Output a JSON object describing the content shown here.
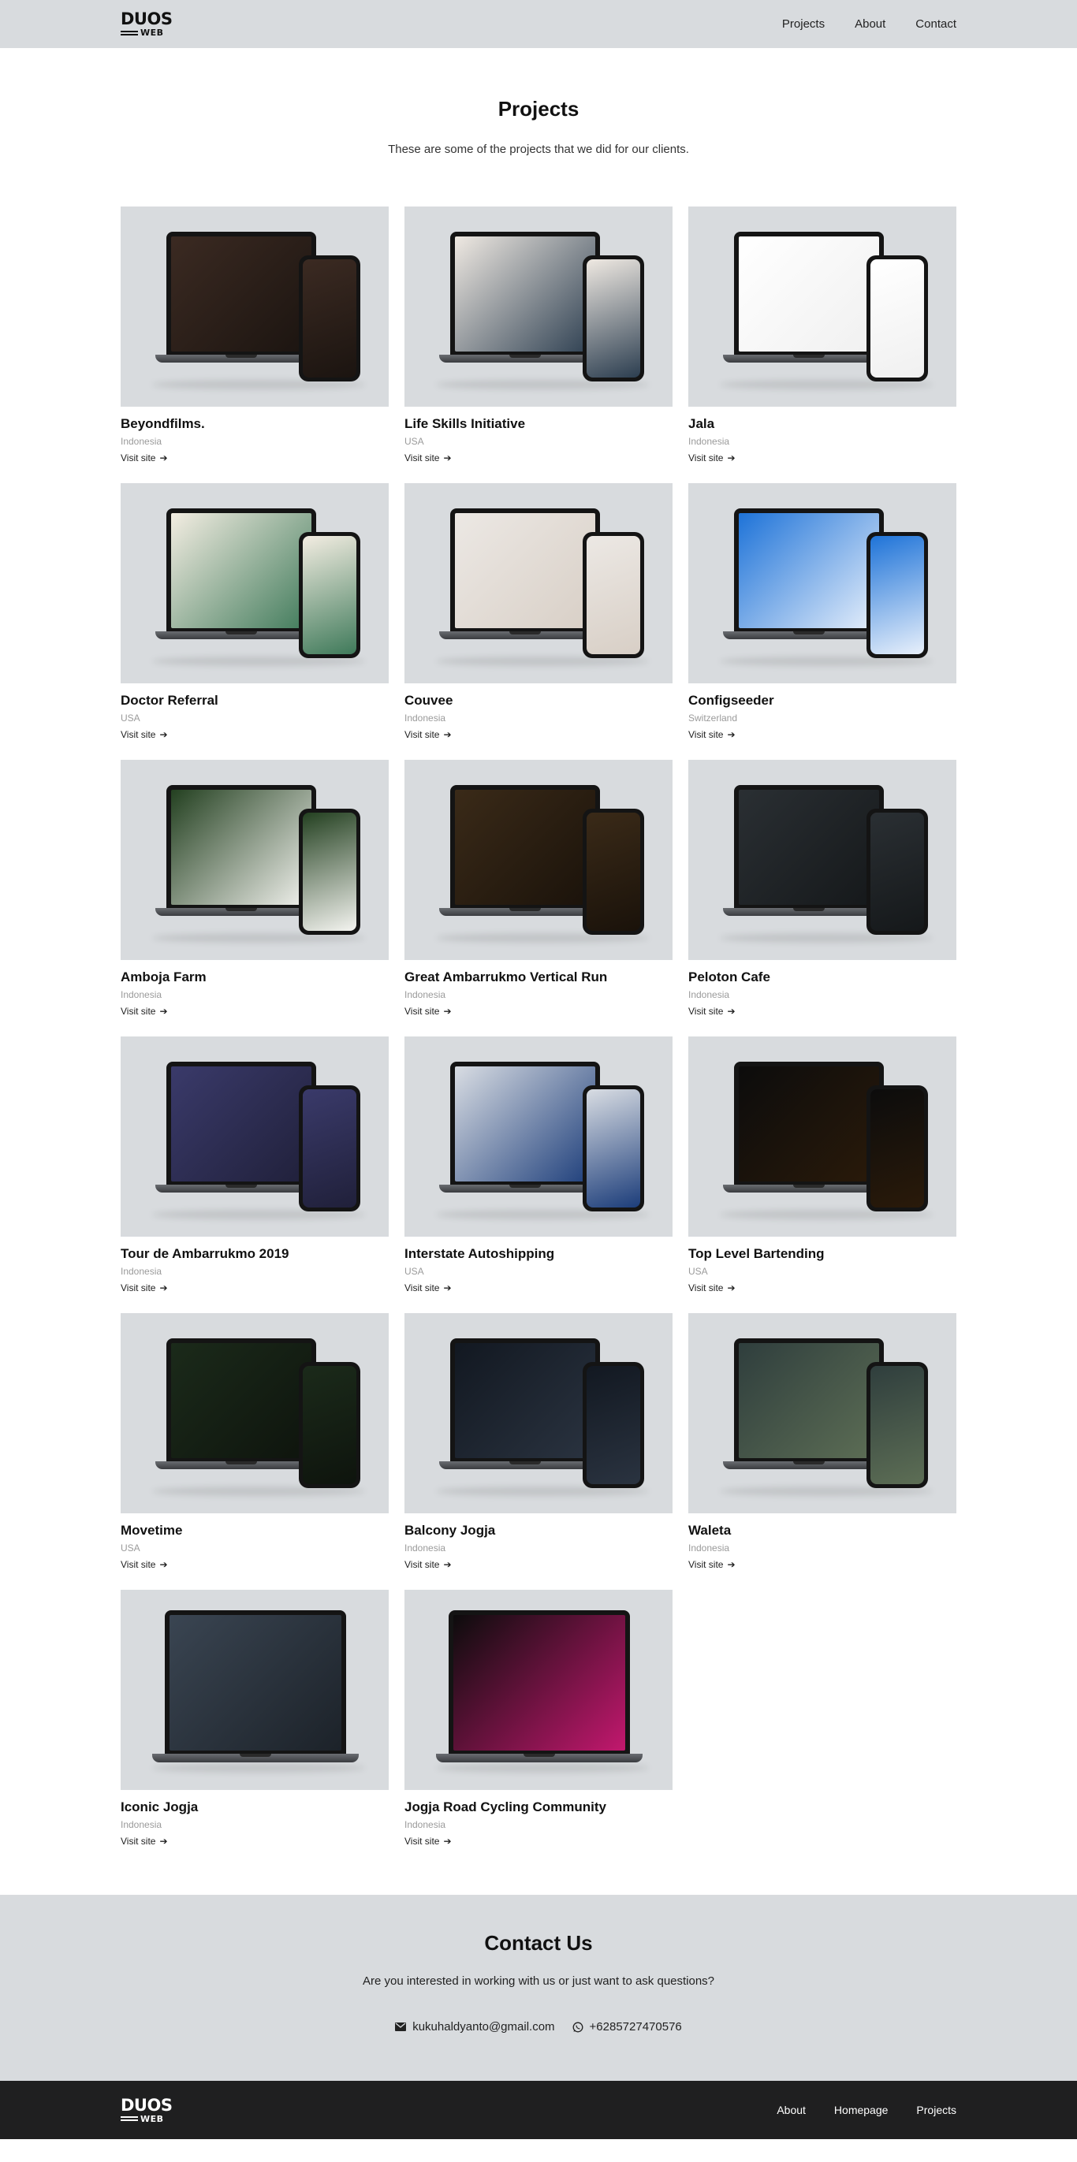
{
  "header": {
    "logo_top": "DUOS",
    "logo_bottom": "WEB",
    "nav": [
      "Projects",
      "About",
      "Contact"
    ]
  },
  "projects": {
    "title": "Projects",
    "description": "These are some of the projects that we did for our clients.",
    "link_label": "Visit site",
    "items": [
      {
        "name": "Beyondfilms.",
        "country": "Indonesia"
      },
      {
        "name": "Life Skills Initiative",
        "country": "USA"
      },
      {
        "name": "Jala",
        "country": "Indonesia"
      },
      {
        "name": "Doctor Referral",
        "country": "USA"
      },
      {
        "name": "Couvee",
        "country": "Indonesia"
      },
      {
        "name": "Configseeder",
        "country": "Switzerland"
      },
      {
        "name": "Amboja Farm",
        "country": "Indonesia"
      },
      {
        "name": "Great Ambarrukmo Vertical Run",
        "country": "Indonesia"
      },
      {
        "name": "Peloton Cafe",
        "country": "Indonesia"
      },
      {
        "name": "Tour de Ambarrukmo 2019",
        "country": "Indonesia"
      },
      {
        "name": "Interstate Autoshipping",
        "country": "USA"
      },
      {
        "name": "Top Level Bartending",
        "country": "USA"
      },
      {
        "name": "Movetime",
        "country": "USA"
      },
      {
        "name": "Balcony Jogja",
        "country": "Indonesia"
      },
      {
        "name": "Waleta",
        "country": "Indonesia"
      },
      {
        "name": "Iconic Jogja",
        "country": "Indonesia"
      },
      {
        "name": "Jogja Road Cycling Community",
        "country": "Indonesia"
      }
    ]
  },
  "contact": {
    "title": "Contact Us",
    "description": "Are you interested in working with us or just want to ask questions?",
    "email": "kukuhaldyanto@gmail.com",
    "phone": "+6285727470576"
  },
  "footer": {
    "logo_top": "DUOS",
    "logo_bottom": "WEB",
    "nav": [
      "About",
      "Homepage",
      "Projects"
    ]
  },
  "colors": {
    "header_bg": "#d8dbde",
    "footer_bg": "#1f1f20",
    "thumb_bg": "#d8dbde"
  }
}
